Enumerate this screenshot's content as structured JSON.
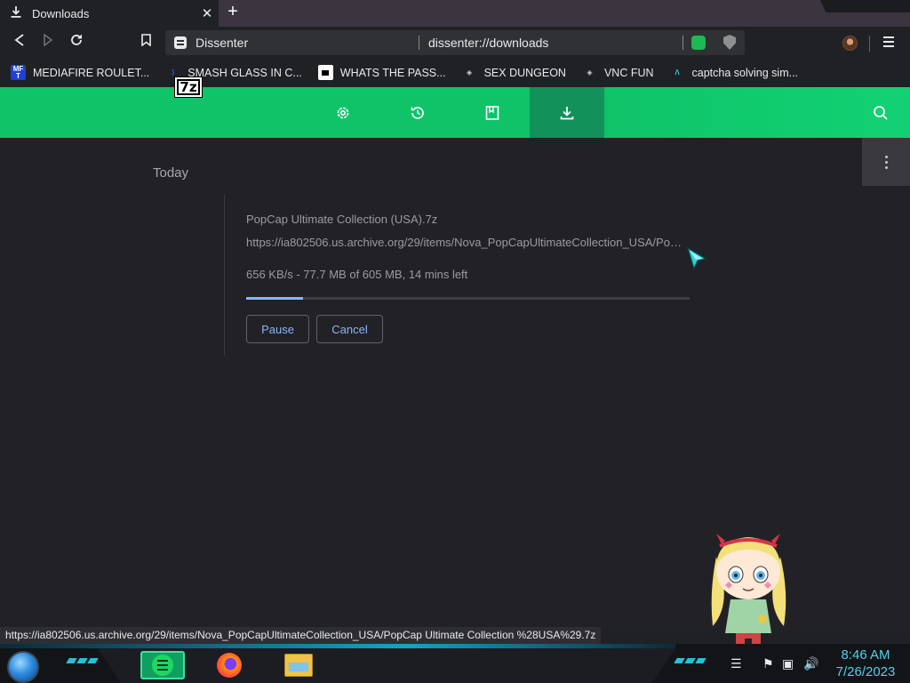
{
  "browser": {
    "tab": {
      "title": "Downloads",
      "icon": "download-icon",
      "close_label": "✕"
    },
    "new_tab_label": "+",
    "omnibox": {
      "site_name": "Dissenter",
      "url": "dissenter://downloads"
    },
    "bookmarks": [
      {
        "label": "MEDIAFIRE ROULET...",
        "icon": "mediafire-icon"
      },
      {
        "label": "SMASH GLASS IN C...",
        "icon": "smash-icon"
      },
      {
        "label": "WHATS THE PASS...",
        "icon": "pass-icon"
      },
      {
        "label": "SEX DUNGEON",
        "icon": "dungeon-icon"
      },
      {
        "label": "VNC FUN",
        "icon": "vnc-icon"
      },
      {
        "label": "captcha solving sim...",
        "icon": "captcha-icon"
      }
    ]
  },
  "downloads_page": {
    "nav_icons": [
      "settings-icon",
      "history-icon",
      "bookmarks-icon",
      "downloads-icon"
    ],
    "active_nav": "downloads-icon",
    "accent_color": "#0fc369",
    "day_label": "Today",
    "item": {
      "file_icon_label": "7z",
      "filename": "PopCap Ultimate Collection (USA).7z",
      "url": "https://ia802506.us.archive.org/29/items/Nova_PopCapUltimateCollection_USA/PopCap%20Ultimate%20Collection%20%28USA%29.7z",
      "status": "656 KB/s - 77.7 MB of 605 MB, 14 mins left",
      "progress_fraction": 0.128,
      "pause_label": "Pause",
      "cancel_label": "Cancel"
    }
  },
  "status_bubble": "https://ia802506.us.archive.org/29/items/Nova_PopCapUltimateCollection_USA/PopCap Ultimate Collection %28USA%29.7z",
  "taskbar": {
    "apps": [
      "spotify-icon",
      "firefox-icon",
      "file-explorer-icon"
    ],
    "clock_time": "8:46 AM",
    "clock_date": "7/26/2023"
  }
}
